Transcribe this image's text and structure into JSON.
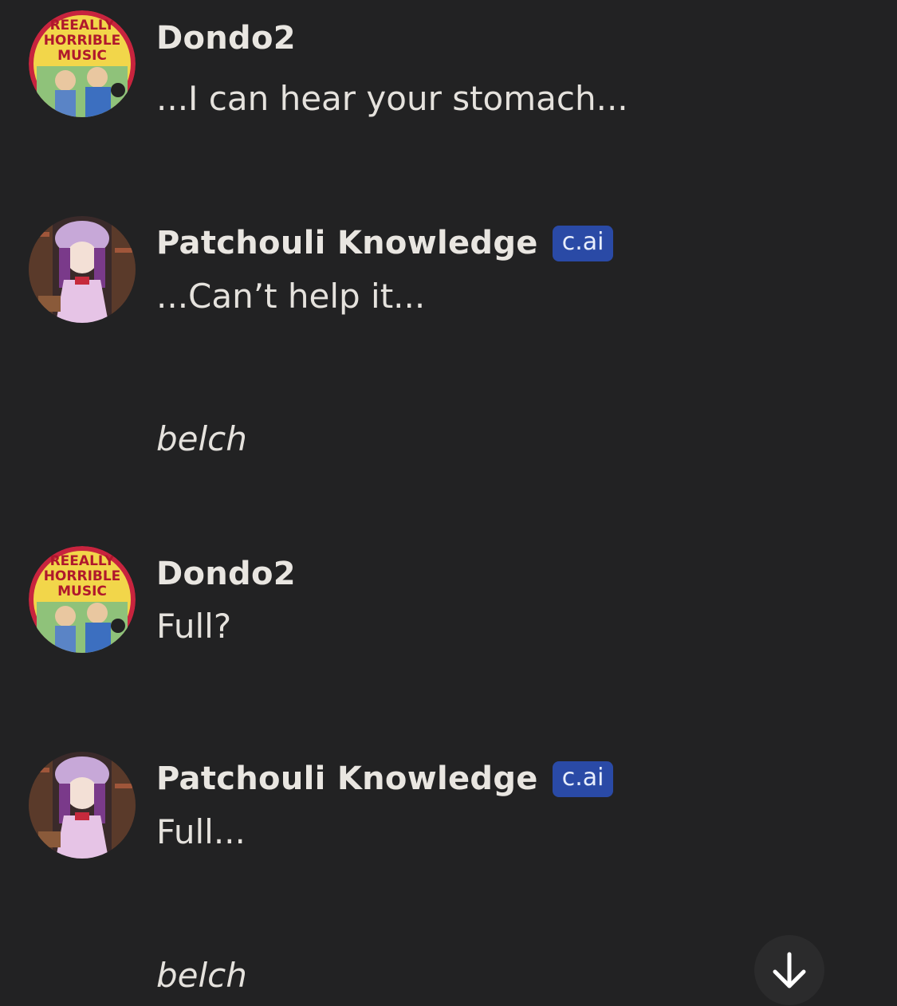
{
  "messages": [
    {
      "author": "Dondo2",
      "avatar": "reeally-horrible-music-avatar",
      "avatar_text": [
        "REEALLY",
        "HORRIBLE",
        "MUSIC"
      ],
      "text": "...I can hear your stomach..."
    },
    {
      "author": "Patchouli Knowledge",
      "avatar": "patchouli-avatar",
      "badge": "c.ai",
      "text": "...Can’t help it...",
      "action": "belch"
    },
    {
      "author": "Dondo2",
      "avatar": "reeally-horrible-music-avatar",
      "avatar_text": [
        "REEALLY",
        "HORRIBLE",
        "MUSIC"
      ],
      "text": "Full?"
    },
    {
      "author": "Patchouli Knowledge",
      "avatar": "patchouli-avatar",
      "badge": "c.ai",
      "text": "Full...",
      "action": "belch"
    }
  ],
  "scroll_button": {
    "icon": "arrow-down-icon"
  },
  "colors": {
    "background": "#222223",
    "text": "#e5e2dd",
    "badge": "#2a4aa6"
  }
}
